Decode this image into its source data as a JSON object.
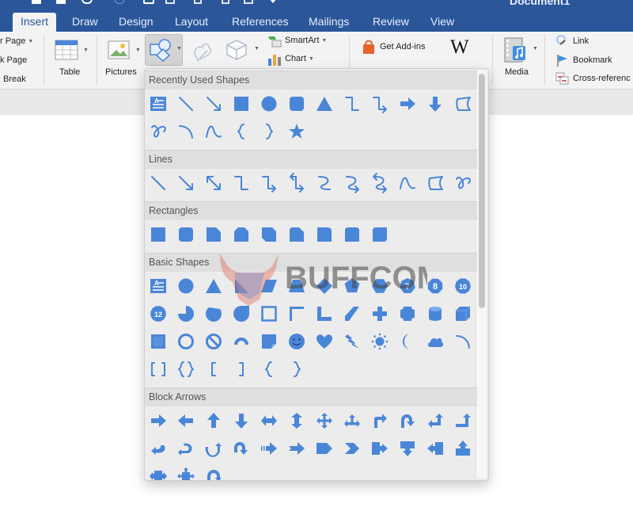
{
  "window": {
    "title": "Document1"
  },
  "tabs": [
    {
      "label": "Insert",
      "active": true
    },
    {
      "label": "Draw"
    },
    {
      "label": "Design"
    },
    {
      "label": "Layout"
    },
    {
      "label": "References"
    },
    {
      "label": "Mailings"
    },
    {
      "label": "Review"
    },
    {
      "label": "View"
    }
  ],
  "ribbon": {
    "pages": {
      "cover_page": "r Page",
      "blank_page": "k Page",
      "page_break": "Break"
    },
    "table": "Table",
    "pictures": "Pictures",
    "smartart": "SmartArt",
    "chart": "Chart",
    "get_addins": "Get Add-ins",
    "wikipedia": "W",
    "media": "Media",
    "link": "Link",
    "bookmark": "Bookmark",
    "cross_reference": "Cross-referenc"
  },
  "shapes_menu": {
    "sections": [
      {
        "title": "Recently Used Shapes",
        "items": [
          "text-box",
          "line",
          "arrow-line",
          "rectangle",
          "oval",
          "rounded-rectangle",
          "triangle",
          "elbow-connector",
          "elbow-arrow-connector",
          "right-arrow",
          "down-arrow",
          "freeform",
          "scribble",
          "arc",
          "curve",
          "left-brace",
          "right-brace",
          "star"
        ]
      },
      {
        "title": "Lines",
        "items": [
          "line",
          "arrow",
          "double-arrow",
          "elbow-connector",
          "elbow-arrow-connector",
          "elbow-double-arrow-connector",
          "curved-connector",
          "curved-arrow-connector",
          "curved-double-arrow-connector",
          "curve",
          "freeform",
          "scribble"
        ]
      },
      {
        "title": "Rectangles",
        "items": [
          "rectangle",
          "rounded-rectangle",
          "snip-single-corner",
          "snip-same-side",
          "snip-diagonal",
          "snip-round",
          "round-single-corner",
          "round-same-side",
          "round-diagonal"
        ]
      },
      {
        "title": "Basic Shapes",
        "items": [
          "text-box",
          "oval",
          "isosceles-triangle",
          "right-triangle",
          "parallelogram",
          "trapezoid",
          "diamond",
          "pentagon",
          "hexagon",
          "heptagon",
          "octagon",
          "decagon",
          "dodecagon",
          "pie",
          "chord",
          "teardrop",
          "frame",
          "half-frame",
          "l-shape",
          "diagonal-stripe",
          "cross",
          "plaque",
          "can",
          "cube",
          "bevel",
          "donut",
          "no-symbol",
          "block-arc",
          "folded-corner",
          "smiley-face",
          "heart",
          "lightning-bolt",
          "sun",
          "moon",
          "cloud",
          "arc",
          "double-bracket",
          "double-brace",
          "left-bracket",
          "right-bracket",
          "left-brace",
          "right-brace"
        ]
      },
      {
        "title": "Block Arrows",
        "items": [
          "right-arrow",
          "left-arrow",
          "up-arrow",
          "down-arrow",
          "left-right-arrow",
          "up-down-arrow",
          "quad-arrow",
          "left-right-up-arrow",
          "bent-arrow",
          "u-turn-arrow",
          "left-up-arrow",
          "bent-up-arrow",
          "curved-right-arrow",
          "curved-left-arrow",
          "curved-up-arrow",
          "curved-down-arrow",
          "striped-right-arrow",
          "notched-right-arrow",
          "pentagon-arrow",
          "chevron",
          "right-arrow-callout",
          "down-arrow-callout",
          "left-arrow-callout",
          "up-arrow-callout",
          "left-right-arrow-callout",
          "quad-arrow-callout",
          "circular-arrow"
        ]
      }
    ],
    "polygon_labels": {
      "heptagon": "7",
      "octagon": "8",
      "decagon": "10",
      "dodecagon": "12"
    }
  },
  "watermark": {
    "text": "BUFFCOM"
  },
  "colors": {
    "accent": "#2b579a",
    "shape_fill": "#4a86d8",
    "menu_bg": "#ececec",
    "header_bg": "#dfdfdf"
  }
}
